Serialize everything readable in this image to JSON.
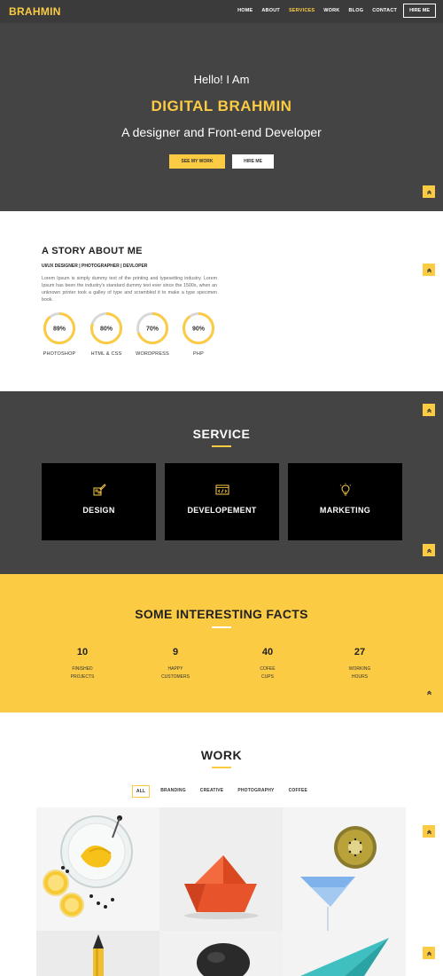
{
  "nav": {
    "logo": "BRAHMIN",
    "items": [
      "HOME",
      "ABOUT",
      "SERVICES",
      "WORK",
      "BLOG",
      "CONTACT"
    ],
    "active": "SERVICES",
    "hire": "HIRE ME"
  },
  "hero": {
    "hello": "Hello! I Am",
    "name": "DIGITAL BRAHMIN",
    "subtitle": "A designer and Front-end Developer",
    "btn_primary": "SEE MY WORK",
    "btn_secondary": "HIRE ME"
  },
  "about": {
    "title": "A STORY ABOUT ME",
    "role": "UI/UX DESIGNER | PHOTOGRAPHER | DEVLOPER",
    "text": "Lorem Ipsum is simply dummy text of the printing and typesetting industry. Lorem Ipsum has been the industry's standard dummy text ever since the 1500s, when an unknown printer took a galley of type and scrambled it to make a type specimen book.",
    "skills": [
      {
        "label": "PHOTOSHOP",
        "value": "89%",
        "percent": 89
      },
      {
        "label": "HTML & CSS",
        "value": "80%",
        "percent": 80
      },
      {
        "label": "WORDPRESS",
        "value": "70%",
        "percent": 70
      },
      {
        "label": "PHP",
        "value": "90%",
        "percent": 90
      }
    ]
  },
  "service": {
    "title": "SERVICE",
    "cards": [
      {
        "label": "DESIGN",
        "icon": "design-icon"
      },
      {
        "label": "DEVELOPEMENT",
        "icon": "code-icon"
      },
      {
        "label": "MARKETING",
        "icon": "lightbulb-icon"
      }
    ]
  },
  "facts": {
    "title": "SOME INTERESTING FACTS",
    "items": [
      {
        "number": "10",
        "line1": "FINISHED",
        "line2": "PROJECTS"
      },
      {
        "number": "9",
        "line1": "HAPPY",
        "line2": "CUSTOMERS"
      },
      {
        "number": "40",
        "line1": "COFEE",
        "line2": "CUPS"
      },
      {
        "number": "27",
        "line1": "WORKING",
        "line2": "HOURS"
      }
    ]
  },
  "work": {
    "title": "WORK",
    "filters": [
      "ALL",
      "BRANDING",
      "CREATIVE",
      "PHOTOGRAPHY",
      "COFFEE"
    ],
    "active_filter": "ALL"
  },
  "colors": {
    "accent": "#fccb44",
    "dark": "#444444",
    "nav": "#3b3b3b"
  }
}
